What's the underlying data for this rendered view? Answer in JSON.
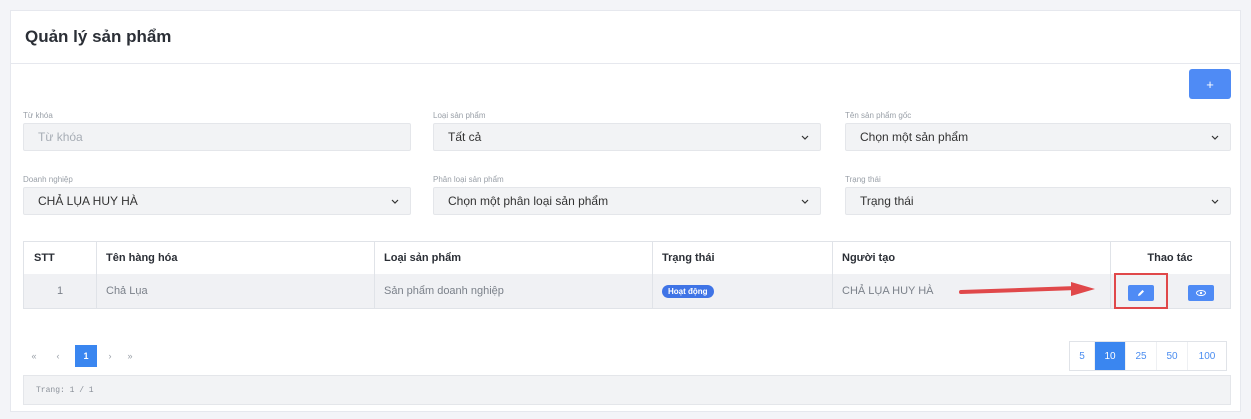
{
  "page": {
    "title": "Quản lý sản phẩm",
    "add_label": "+"
  },
  "filters": {
    "keyword": {
      "label": "Từ khóa",
      "placeholder": "Từ khóa",
      "value": ""
    },
    "product_type": {
      "label": "Loại sản phẩm",
      "value": "Tất cả"
    },
    "original_product": {
      "label": "Tên sản phẩm gốc",
      "value": "Chọn một sản phẩm"
    },
    "enterprise": {
      "label": "Doanh nghiệp",
      "value": "CHẢ LỤA HUY HÀ"
    },
    "product_category": {
      "label": "Phân loại sản phẩm",
      "value": "Chọn một phân loại sản phẩm"
    },
    "status": {
      "label": "Trạng thái",
      "value": "Trạng thái"
    }
  },
  "table": {
    "headers": [
      "STT",
      "Tên hàng hóa",
      "Loại sản phẩm",
      "Trạng thái",
      "Người tạo",
      "Thao tác"
    ],
    "rows": [
      {
        "stt": "1",
        "name": "Chả Lụa",
        "type": "Sản phẩm doanh nghiệp",
        "status": "Hoạt động",
        "creator": "CHẢ LỤA HUY HÀ"
      }
    ]
  },
  "pagination": {
    "first": "«",
    "prev": "‹",
    "current": "1",
    "next": "›",
    "last": "»",
    "sizes": [
      "5",
      "10",
      "25",
      "50",
      "100"
    ],
    "active_size": "10",
    "info": "Trang: 1 / 1"
  },
  "colors": {
    "primary": "#4f8bf5",
    "highlight": "#e0484a"
  }
}
